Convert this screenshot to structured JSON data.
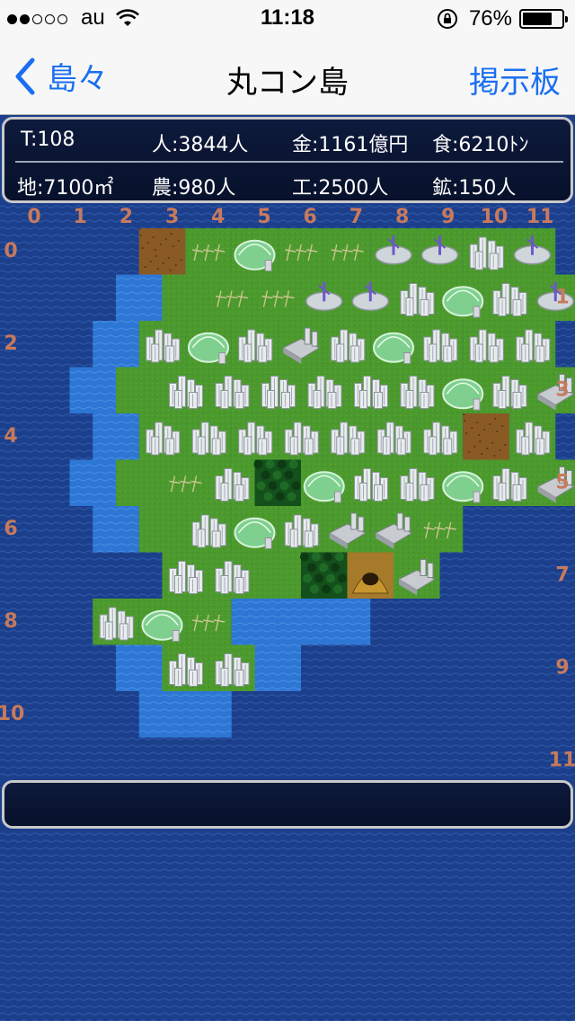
{
  "status_bar": {
    "carrier": "au",
    "time": "11:18",
    "battery_percent": "76%",
    "battery_level": 0.76,
    "signal_bars_filled": 2,
    "signal_bars_total": 5
  },
  "nav": {
    "back_label": "島々",
    "title": "丸コン島",
    "board_label": "掲示板"
  },
  "stats": {
    "turn": "T:108",
    "population": "人:3844人",
    "money": "金:1161億円",
    "food": "食:6210ﾄﾝ",
    "area": "地:7100㎡",
    "farm": "農:980人",
    "industry": "工:2500人",
    "mine": "鉱:150人"
  },
  "map": {
    "col_labels": [
      "0",
      "1",
      "2",
      "3",
      "4",
      "5",
      "6",
      "7",
      "8",
      "9",
      "10",
      "11"
    ],
    "row_labels": [
      "0",
      "1",
      "2",
      "3",
      "4",
      "5",
      "6",
      "7",
      "8",
      "9",
      "10",
      "11"
    ],
    "legend": {
      "D": "deep-sea",
      "S": "shallow-sea",
      "P": "plains",
      "W": "wasteland",
      "C": "town",
      "F": "farm-dome",
      "R": "wind-farm",
      "A": "farm-field",
      "I": "factory",
      "G": "forest",
      "M": "mine"
    },
    "rows": [
      "DDDWAFAARRCR",
      "DDSPAARRCFCR",
      "DDSCFCICFCCC",
      "DSPCCCCCCFCI",
      "DDSCCCCCCCWCR",
      "DSPACGFCCFCI",
      "DDSPCFCIIADD",
      "DDDCCPGMIDDD",
      "DDCFASSSDDDD",
      "DDSCCSDDDDDD",
      "DDDSSDDDDDDD",
      "DDDDDDDDDDDD"
    ]
  },
  "colors": {
    "deep_sea": "#1c3f8c",
    "shallow_sea": "#2d76d4",
    "plains": "#4c9a2e",
    "wasteland": "#8a5a24",
    "forest": "#14501c",
    "label": "#c77a5d",
    "accent": "#1a6ff0"
  }
}
